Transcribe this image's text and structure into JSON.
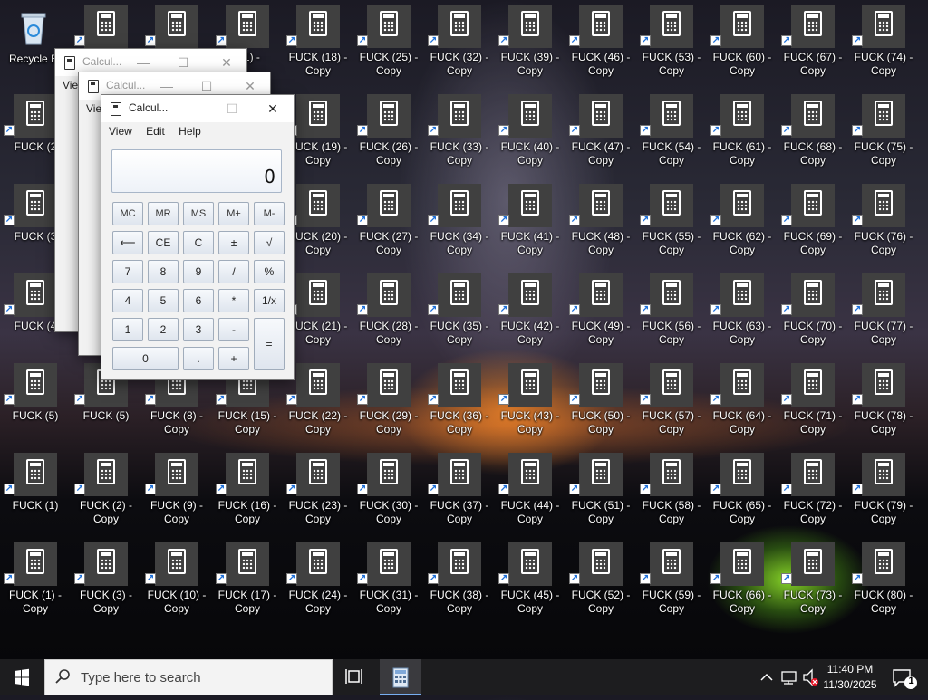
{
  "desktop": {
    "recycle_bin": {
      "label": "Recycle B"
    },
    "icons": [
      {
        "col": 0,
        "row": 1,
        "label": "FUCK (2"
      },
      {
        "col": 0,
        "row": 2,
        "label": "FUCK (3"
      },
      {
        "col": 0,
        "row": 3,
        "label": "FUCK (4"
      },
      {
        "col": 0,
        "row": 4,
        "label": "FUCK (5)"
      },
      {
        "col": 0,
        "row": 5,
        "label": "FUCK (1)"
      },
      {
        "col": 0,
        "row": 6,
        "label": "FUCK (1) -\nCopy"
      },
      {
        "col": 1,
        "row": 0,
        "label": ""
      },
      {
        "col": 1,
        "row": 4,
        "label": "FUCK (5)"
      },
      {
        "col": 1,
        "row": 5,
        "label": "FUCK (2) -\nCopy"
      },
      {
        "col": 1,
        "row": 6,
        "label": "FUCK (3) -\nCopy"
      },
      {
        "col": 2,
        "row": 0,
        "label": ""
      },
      {
        "col": 2,
        "row": 4,
        "label": "FUCK (8) -\nCopy"
      },
      {
        "col": 2,
        "row": 5,
        "label": "FUCK (9) -\nCopy"
      },
      {
        "col": 2,
        "row": 6,
        "label": "FUCK (10) -\nCopy"
      },
      {
        "col": 3,
        "row": 0,
        "label": "(11) -"
      },
      {
        "col": 3,
        "row": 4,
        "label": "FUCK (15) -\nCopy"
      },
      {
        "col": 3,
        "row": 5,
        "label": "FUCK (16) -\nCopy"
      },
      {
        "col": 3,
        "row": 6,
        "label": "FUCK (17) -\nCopy"
      },
      {
        "col": 4,
        "row": 0,
        "label": "FUCK (18) -\nCopy"
      },
      {
        "col": 4,
        "row": 1,
        "label": "FUCK (19) -\nCopy"
      },
      {
        "col": 4,
        "row": 2,
        "label": "FUCK (20) -\nCopy"
      },
      {
        "col": 4,
        "row": 3,
        "label": "FUCK (21) -\nCopy"
      },
      {
        "col": 4,
        "row": 4,
        "label": "FUCK (22) -\nCopy"
      },
      {
        "col": 4,
        "row": 5,
        "label": "FUCK (23) -\nCopy"
      },
      {
        "col": 4,
        "row": 6,
        "label": "FUCK (24) -\nCopy"
      },
      {
        "col": 5,
        "row": 0,
        "label": "FUCK (25) -\nCopy"
      },
      {
        "col": 5,
        "row": 1,
        "label": "FUCK (26) -\nCopy"
      },
      {
        "col": 5,
        "row": 2,
        "label": "FUCK (27) -\nCopy"
      },
      {
        "col": 5,
        "row": 3,
        "label": "FUCK (28) -\nCopy"
      },
      {
        "col": 5,
        "row": 4,
        "label": "FUCK (29) -\nCopy"
      },
      {
        "col": 5,
        "row": 5,
        "label": "FUCK (30) -\nCopy"
      },
      {
        "col": 5,
        "row": 6,
        "label": "FUCK (31) -\nCopy"
      },
      {
        "col": 6,
        "row": 0,
        "label": "FUCK (32) -\nCopy"
      },
      {
        "col": 6,
        "row": 1,
        "label": "FUCK (33) -\nCopy"
      },
      {
        "col": 6,
        "row": 2,
        "label": "FUCK (34) -\nCopy"
      },
      {
        "col": 6,
        "row": 3,
        "label": "FUCK (35) -\nCopy"
      },
      {
        "col": 6,
        "row": 4,
        "label": "FUCK (36) -\nCopy"
      },
      {
        "col": 6,
        "row": 5,
        "label": "FUCK (37) -\nCopy"
      },
      {
        "col": 6,
        "row": 6,
        "label": "FUCK (38) -\nCopy"
      },
      {
        "col": 7,
        "row": 0,
        "label": "FUCK (39) -\nCopy"
      },
      {
        "col": 7,
        "row": 1,
        "label": "FUCK (40) -\nCopy"
      },
      {
        "col": 7,
        "row": 2,
        "label": "FUCK (41) -\nCopy"
      },
      {
        "col": 7,
        "row": 3,
        "label": "FUCK (42) -\nCopy"
      },
      {
        "col": 7,
        "row": 4,
        "label": "FUCK (43) -\nCopy"
      },
      {
        "col": 7,
        "row": 5,
        "label": "FUCK (44) -\nCopy"
      },
      {
        "col": 7,
        "row": 6,
        "label": "FUCK (45) -\nCopy"
      },
      {
        "col": 8,
        "row": 0,
        "label": "FUCK (46) -\nCopy"
      },
      {
        "col": 8,
        "row": 1,
        "label": "FUCK (47) -\nCopy"
      },
      {
        "col": 8,
        "row": 2,
        "label": "FUCK (48) -\nCopy"
      },
      {
        "col": 8,
        "row": 3,
        "label": "FUCK (49) -\nCopy"
      },
      {
        "col": 8,
        "row": 4,
        "label": "FUCK (50) -\nCopy"
      },
      {
        "col": 8,
        "row": 5,
        "label": "FUCK (51) -\nCopy"
      },
      {
        "col": 8,
        "row": 6,
        "label": "FUCK (52) -\nCopy"
      },
      {
        "col": 9,
        "row": 0,
        "label": "FUCK (53) -\nCopy"
      },
      {
        "col": 9,
        "row": 1,
        "label": "FUCK (54) -\nCopy"
      },
      {
        "col": 9,
        "row": 2,
        "label": "FUCK (55) -\nCopy"
      },
      {
        "col": 9,
        "row": 3,
        "label": "FUCK (56) -\nCopy"
      },
      {
        "col": 9,
        "row": 4,
        "label": "FUCK (57) -\nCopy"
      },
      {
        "col": 9,
        "row": 5,
        "label": "FUCK (58) -\nCopy"
      },
      {
        "col": 9,
        "row": 6,
        "label": "FUCK (59) -\nCopy"
      },
      {
        "col": 10,
        "row": 0,
        "label": "FUCK (60) -\nCopy"
      },
      {
        "col": 10,
        "row": 1,
        "label": "FUCK (61) -\nCopy"
      },
      {
        "col": 10,
        "row": 2,
        "label": "FUCK (62) -\nCopy"
      },
      {
        "col": 10,
        "row": 3,
        "label": "FUCK (63) -\nCopy"
      },
      {
        "col": 10,
        "row": 4,
        "label": "FUCK (64) -\nCopy"
      },
      {
        "col": 10,
        "row": 5,
        "label": "FUCK (65) -\nCopy"
      },
      {
        "col": 10,
        "row": 6,
        "label": "FUCK (66) -\nCopy"
      },
      {
        "col": 11,
        "row": 0,
        "label": "FUCK (67) -\nCopy"
      },
      {
        "col": 11,
        "row": 1,
        "label": "FUCK (68) -\nCopy"
      },
      {
        "col": 11,
        "row": 2,
        "label": "FUCK (69) -\nCopy"
      },
      {
        "col": 11,
        "row": 3,
        "label": "FUCK (70) -\nCopy"
      },
      {
        "col": 11,
        "row": 4,
        "label": "FUCK (71) -\nCopy"
      },
      {
        "col": 11,
        "row": 5,
        "label": "FUCK (72) -\nCopy"
      },
      {
        "col": 11,
        "row": 6,
        "label": "FUCK (73) -\nCopy"
      },
      {
        "col": 12,
        "row": 0,
        "label": "FUCK (74) -\nCopy"
      },
      {
        "col": 12,
        "row": 1,
        "label": "FUCK (75) -\nCopy"
      },
      {
        "col": 12,
        "row": 2,
        "label": "FUCK (76) -\nCopy"
      },
      {
        "col": 12,
        "row": 3,
        "label": "FUCK (77) -\nCopy"
      },
      {
        "col": 12,
        "row": 4,
        "label": "FUCK (78) -\nCopy"
      },
      {
        "col": 12,
        "row": 5,
        "label": "FUCK (79) -\nCopy"
      },
      {
        "col": 12,
        "row": 6,
        "label": "FUCK (80) -\nCopy"
      }
    ]
  },
  "back_windows": [
    {
      "title": "Calcul...",
      "menu_first": "View"
    },
    {
      "title": "Calcul...",
      "menu_first": "View"
    }
  ],
  "calculator": {
    "title": "Calcul...",
    "minimize": "—",
    "maximize": "☐",
    "close": "✕",
    "menu": [
      "View",
      "Edit",
      "Help"
    ],
    "display": "0",
    "keys": [
      [
        "MC",
        "MR",
        "MS",
        "M+",
        "M-"
      ],
      [
        "⟵",
        "CE",
        "C",
        "±",
        "√"
      ],
      [
        "7",
        "8",
        "9",
        "/",
        "%"
      ],
      [
        "4",
        "5",
        "6",
        "*",
        "1/x"
      ],
      [
        "1",
        "2",
        "3",
        "-",
        "="
      ],
      [
        "0",
        ".",
        "+"
      ]
    ]
  },
  "taskbar": {
    "search_placeholder": "Type here to search",
    "time": "11:40 PM",
    "date": "11/30/2025",
    "notification_count": "1"
  }
}
